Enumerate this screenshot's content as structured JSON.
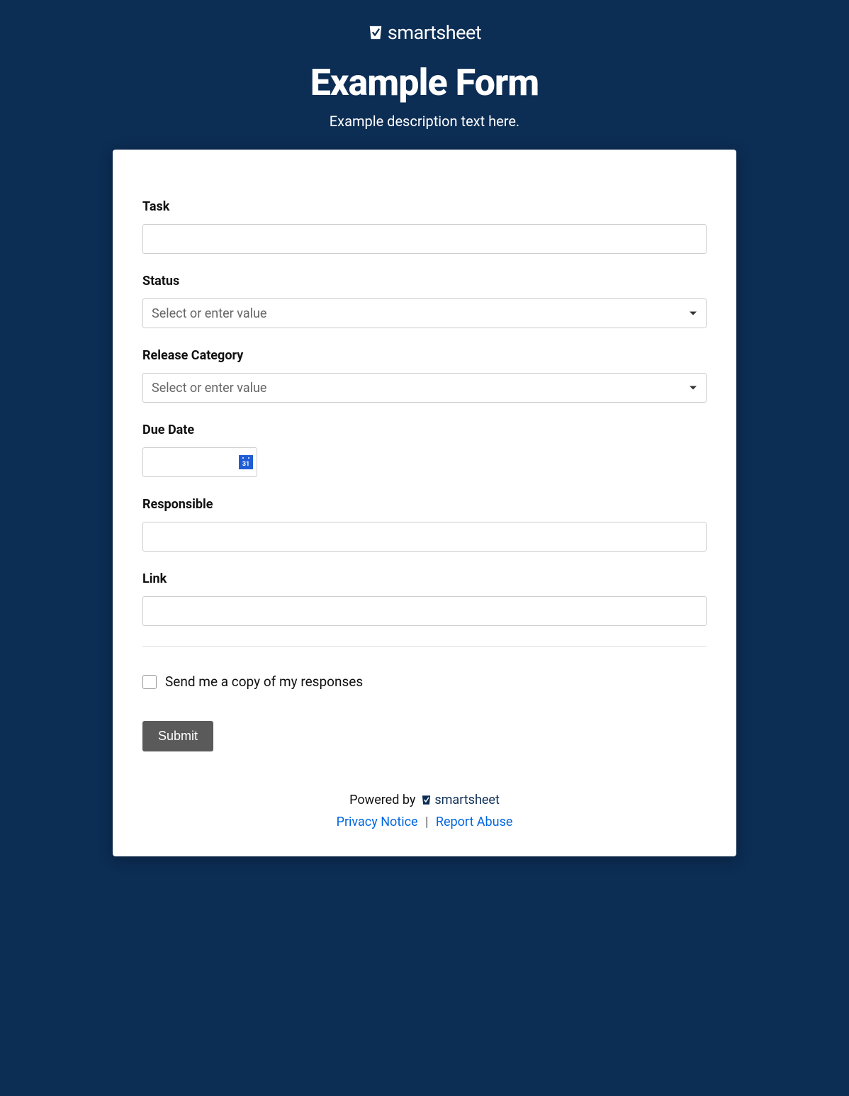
{
  "header": {
    "brand": "smartsheet",
    "title": "Example Form",
    "description": "Example description text here."
  },
  "fields": {
    "task": {
      "label": "Task",
      "value": ""
    },
    "status": {
      "label": "Status",
      "placeholder": "Select or enter value"
    },
    "release_category": {
      "label": "Release Category",
      "placeholder": "Select or enter value"
    },
    "due_date": {
      "label": "Due Date",
      "value": ""
    },
    "responsible": {
      "label": "Responsible",
      "value": ""
    },
    "link": {
      "label": "Link",
      "value": ""
    }
  },
  "checkbox": {
    "send_copy": "Send me a copy of my responses"
  },
  "buttons": {
    "submit": "Submit"
  },
  "footer": {
    "powered_by": "Powered by",
    "brand": "smartsheet",
    "privacy": "Privacy Notice",
    "separator": "|",
    "report": "Report Abuse"
  }
}
